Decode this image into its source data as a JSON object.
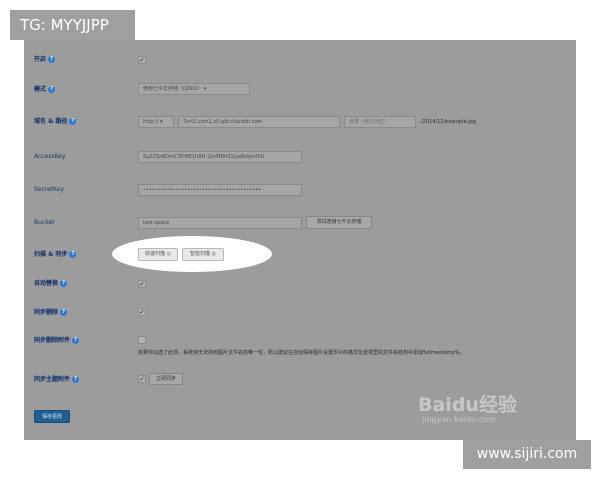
{
  "watermarks": {
    "tag": "TG: MYYJJPP",
    "url": "www.sijiri.com",
    "baidu_logo": "Baidu经验",
    "baidu_sub": "jingyan.baidu.com"
  },
  "form": {
    "enable_label": "开启",
    "mode_label": "模式",
    "mode_value": "使用七牛云存储（QINIU）",
    "domain_label": "域名 & 路径",
    "protocol_value": "http://",
    "domain_value": "7xrt2.com1.z0.glb.clouddn.com",
    "path_placeholder": "目录（可以为空）",
    "path_suffix": "/2014/11/example.jpg",
    "accesskey_label": "AccessKey",
    "accesskey_value": "SyZ2SxBDmC3FrBE1hBH-2znMBriS1jyeBdqmfSU",
    "secretkey_label": "SecretKey",
    "secretkey_value": "••••••••••••••••••••••••••••••••••••••••",
    "bucket_label": "Bucket",
    "bucket_value": "test-space",
    "bucket_button": "测试连接七牛云存储",
    "scan_label": "扫描 & 同步",
    "quick_scan": "快速扫描",
    "smart_scan": "智能扫描",
    "auto_replace_label": "自动替换",
    "sync_delete_label": "同步删除",
    "sync_delete_attach_label": "同步删除附件",
    "sync_delete_attach_note": "如果你勾选了此项，系统将无法找到图片文件名的唯一性，所以建议在自动保存图片设置页中的格式化选项里的文件名结构中添加%timestamp%。",
    "sync_theme_label": "同步主题附件",
    "sync_now": "立即同步",
    "save_button": "保存更改"
  }
}
